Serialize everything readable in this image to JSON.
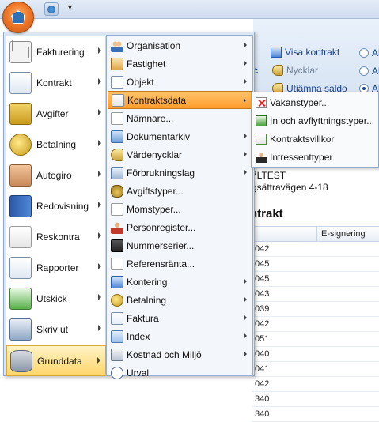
{
  "ribbon": {
    "visa_kontrakt": "Visa kontrakt",
    "nycklar": "Nycklar",
    "utjamna_saldo": "Utjämna saldo",
    "radio_labels": [
      "Al",
      "Al",
      "Al"
    ],
    "partial_c": "c"
  },
  "document": {
    "line1": "7LTEST",
    "line2": "gsättravägen 4-18",
    "heading": "ntrakt",
    "column_header": "E-signering",
    "rows": [
      "042",
      "045",
      "045",
      "043",
      "039",
      "042",
      "051",
      "040",
      "041",
      "042",
      "340",
      "340"
    ]
  },
  "app_menu": {
    "left_items": [
      {
        "label": "Fakturering",
        "icon": "envelope-icon"
      },
      {
        "label": "Kontrakt",
        "icon": "contract-icon"
      },
      {
        "label": "Avgifter",
        "icon": "fees-icon"
      },
      {
        "label": "Betalning",
        "icon": "coins-icon"
      },
      {
        "label": "Autogiro",
        "icon": "handshake-icon"
      },
      {
        "label": "Redovisning",
        "icon": "book-icon"
      },
      {
        "label": "Reskontra",
        "icon": "ledger-scroll-icon"
      },
      {
        "label": "Rapporter",
        "icon": "report-icon"
      },
      {
        "label": "Utskick",
        "icon": "mail-out-icon"
      },
      {
        "label": "Skriv ut",
        "icon": "printer-icon"
      },
      {
        "label": "Grunddata",
        "icon": "database-icon"
      }
    ],
    "selected_left": "Grunddata",
    "submenu": [
      {
        "label": "Organisation",
        "icon": "organisation-icon",
        "arrow": true
      },
      {
        "label": "Fastighet",
        "icon": "property-icon",
        "arrow": true
      },
      {
        "label": "Objekt",
        "icon": "object-icon",
        "arrow": true
      },
      {
        "label": "Kontraktsdata",
        "icon": "contract-data-icon",
        "arrow": true
      },
      {
        "label": "Nämnare...",
        "icon": "name-icon",
        "arrow": false
      },
      {
        "label": "Dokumentarkiv",
        "icon": "archive-icon",
        "arrow": true
      },
      {
        "label": "Värdenycklar",
        "icon": "key-icon",
        "arrow": true
      },
      {
        "label": "Förbrukningslag",
        "icon": "meter-icon",
        "arrow": true
      },
      {
        "label": "Avgiftstyper...",
        "icon": "fee-bag-icon",
        "arrow": false
      },
      {
        "label": "Momstyper...",
        "icon": "percent-icon",
        "arrow": false
      },
      {
        "label": "Personregister...",
        "icon": "person-icon",
        "arrow": false
      },
      {
        "label": "Nummerserier...",
        "icon": "number-series-icon",
        "arrow": false
      },
      {
        "label": "Referensränta...",
        "icon": "percent-icon",
        "arrow": false
      },
      {
        "label": "Kontering",
        "icon": "posting-icon",
        "arrow": true
      },
      {
        "label": "Betalning",
        "icon": "coin-icon",
        "arrow": true
      },
      {
        "label": "Faktura",
        "icon": "invoice-icon",
        "arrow": true
      },
      {
        "label": "Index",
        "icon": "index-icon",
        "arrow": true
      },
      {
        "label": "Kostnad och Miljö",
        "icon": "cost-icon",
        "arrow": true
      },
      {
        "label": "Urval",
        "icon": "selection-icon",
        "arrow": false
      }
    ],
    "highlighted_sub": "Kontraktsdata",
    "flyout": [
      {
        "label": "Vakanstyper...",
        "icon": "vacancy-icon"
      },
      {
        "label": "In och avflyttningstyper...",
        "icon": "move-icon"
      },
      {
        "label": "Kontraktsvillkor",
        "icon": "terms-icon"
      },
      {
        "label": "Intressenttyper",
        "icon": "stakeholder-icon"
      }
    ]
  },
  "colors": {
    "orb": "#f0782a",
    "highlight": "#ff9b2c",
    "selected": "#ffd66a",
    "ribbon_text": "#15428b"
  }
}
